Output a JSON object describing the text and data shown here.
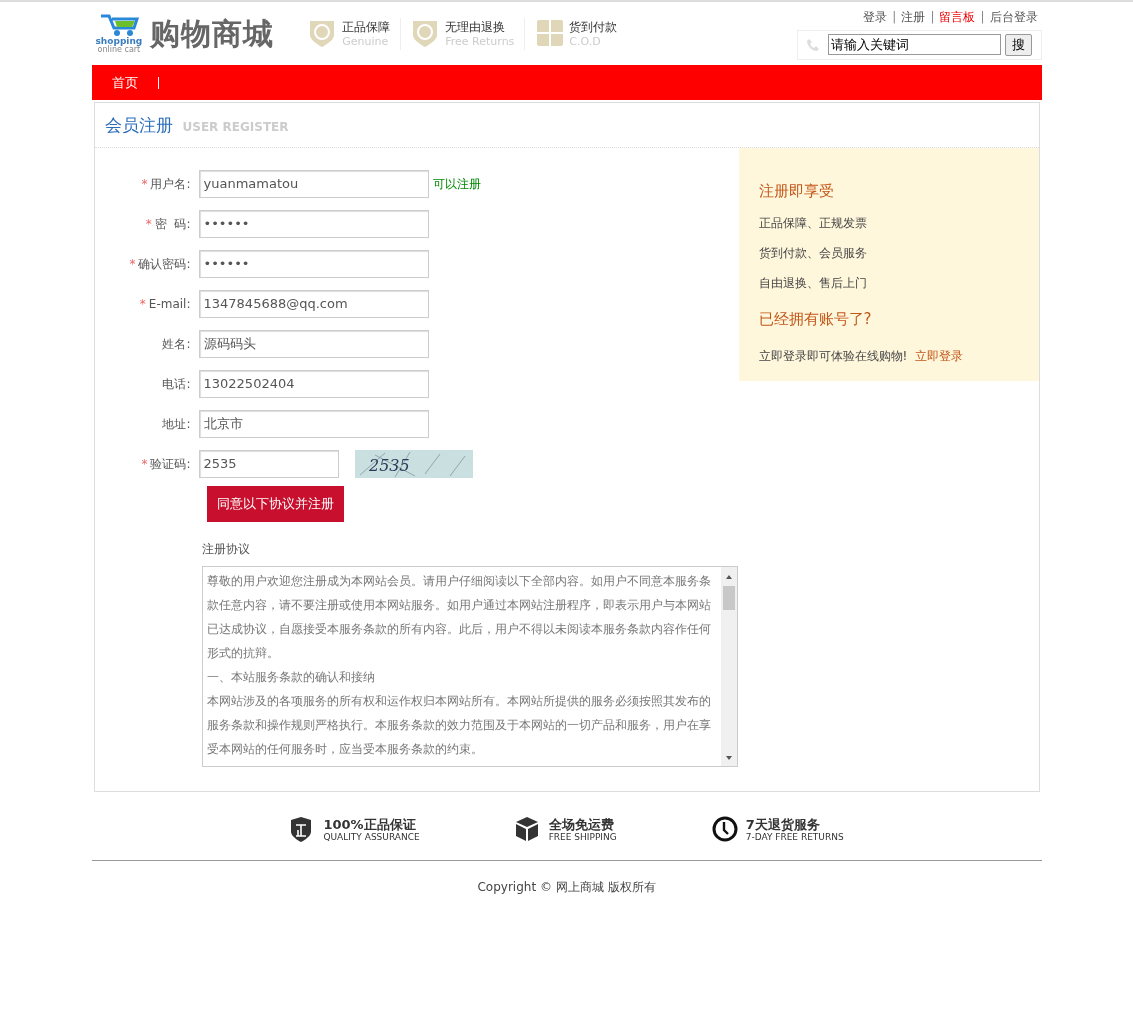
{
  "logo": {
    "title": "购物商城",
    "caption": "shopping",
    "subcaption": "online cart"
  },
  "promises": [
    {
      "kind": "genuine",
      "title": "正品保障",
      "subtitle": "Genuine"
    },
    {
      "kind": "returns",
      "title": "无理由退换",
      "subtitle": "Free Returns"
    },
    {
      "kind": "cod",
      "title": "货到付款",
      "subtitle": "C.O.D"
    }
  ],
  "top_link_separator": "|",
  "top_links": [
    {
      "label": "登录",
      "highlight": false
    },
    {
      "label": "注册",
      "highlight": false
    },
    {
      "label": "留言板",
      "highlight": true
    },
    {
      "label": "后台登录",
      "highlight": false
    }
  ],
  "search": {
    "value": "请输入关键词",
    "button": "搜"
  },
  "nav": [
    "首页"
  ],
  "page_title": {
    "title": "会员注册",
    "subtitle": "USER REGISTER"
  },
  "form": [
    {
      "label": "用户名:",
      "required_mark": "*",
      "value": "yuanmamatou",
      "kind": "text",
      "hint": "可以注册"
    },
    {
      "label": "密  码:",
      "required_mark": "*",
      "value": "••••••",
      "kind": "password"
    },
    {
      "label": "确认密码:",
      "required_mark": "*",
      "value": "••••••",
      "kind": "password"
    },
    {
      "label": "E-mail:",
      "required_mark": "*",
      "value": "1347845688@qq.com",
      "kind": "text"
    },
    {
      "label": "姓名:",
      "value": "源码码头",
      "kind": "text"
    },
    {
      "label": "电话:",
      "value": "13022502404",
      "kind": "text"
    },
    {
      "label": "地址:",
      "value": "北京市",
      "kind": "text"
    },
    {
      "label": "验证码:",
      "required_mark": "*",
      "value": "2535",
      "kind": "captcha",
      "captcha": "2535"
    }
  ],
  "submit": "同意以下协议并注册",
  "agreement": {
    "title": "注册协议",
    "paragraphs": [
      "尊敬的用户欢迎您注册成为本网站会员。请用户仔细阅读以下全部内容。如用户不同意本服务条款任意内容，请不要注册或使用本网站服务。如用户通过本网站注册程序，即表示用户与本网站已达成协议，自愿接受本服务条款的所有内容。此后，用户不得以未阅读本服务条款内容作任何形式的抗辩。",
      "一、本站服务条款的确认和接纳",
      "本网站涉及的各项服务的所有权和运作权归本网站所有。本网站所提供的服务必须按照其发布的服务条款和操作规则严格执行。本服务条款的效力范围及于本网站的一切产品和服务，用户在享受本网站的任何服务时，应当受本服务条款的约束。"
    ]
  },
  "benefits": {
    "title": "注册即享受",
    "items": [
      "正品保障、正规发票",
      "货到付款、会员服务",
      "自由退换、售后上门"
    ],
    "login_title": "已经拥有账号了?",
    "login_text": "立即登录即可体验在线购物!",
    "login_link": "立即登录"
  },
  "footer_features": [
    {
      "kind": "shield",
      "title": "100%正品保证",
      "subtitle": "QUALITY ASSURANCE"
    },
    {
      "kind": "box",
      "title": "全场免运费",
      "subtitle": "FREE SHIPPING"
    },
    {
      "kind": "clock",
      "title": "7天退货服务",
      "subtitle": "7-DAY FREE RETURNS"
    }
  ],
  "copyright": "Copyright © 网上商城 版权所有"
}
